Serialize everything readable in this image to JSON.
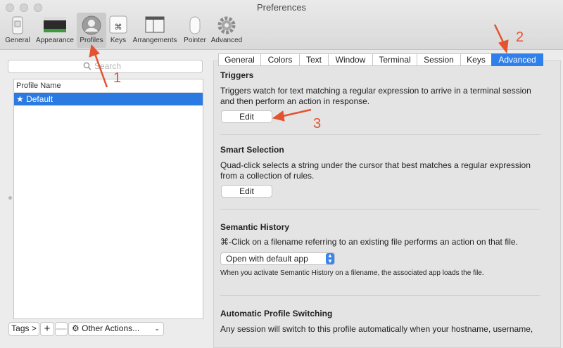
{
  "window": {
    "title": "Preferences"
  },
  "toolbar": {
    "items": [
      {
        "label": "General",
        "icon": "switch-icon"
      },
      {
        "label": "Appearance",
        "icon": "appearance-icon"
      },
      {
        "label": "Profiles",
        "icon": "person-icon"
      },
      {
        "label": "Keys",
        "icon": "command-key-icon"
      },
      {
        "label": "Arrangements",
        "icon": "window-arrangement-icon"
      },
      {
        "label": "Pointer",
        "icon": "mouse-icon"
      },
      {
        "label": "Advanced",
        "icon": "gear-icon"
      }
    ],
    "selected": "Profiles"
  },
  "left": {
    "search": {
      "placeholder": "Search"
    },
    "column_header": "Profile Name",
    "profiles": [
      {
        "name": "★ Default",
        "selected": true
      }
    ],
    "footer": {
      "tags": "Tags >",
      "add": "+",
      "remove": "—",
      "other_actions": "Other Actions..."
    }
  },
  "tabs": {
    "items": [
      "General",
      "Colors",
      "Text",
      "Window",
      "Terminal",
      "Session",
      "Keys",
      "Advanced"
    ],
    "active": "Advanced"
  },
  "sections": {
    "triggers": {
      "title": "Triggers",
      "line1": "Triggers watch for text matching a regular expression to arrive in a terminal session",
      "line2": "and then perform an action in response.",
      "button": "Edit"
    },
    "smart_selection": {
      "title": "Smart Selection",
      "line1": "Quad-click selects a string under the cursor that best matches a regular expression",
      "line2": "from a collection of rules.",
      "button": "Edit"
    },
    "semantic_history": {
      "title": "Semantic History",
      "line1": "⌘-Click on a filename referring to an existing file performs an action on that file.",
      "select_value": "Open with default app",
      "note": "When you activate Semantic History on a filename, the associated app loads the file."
    },
    "auto_switching": {
      "title": "Automatic Profile Switching",
      "line1": "Any session will switch to this profile automatically when your hostname, username,"
    }
  },
  "annotations": {
    "n1": "1",
    "n2": "2",
    "n3": "3",
    "color": "#e5522f"
  }
}
